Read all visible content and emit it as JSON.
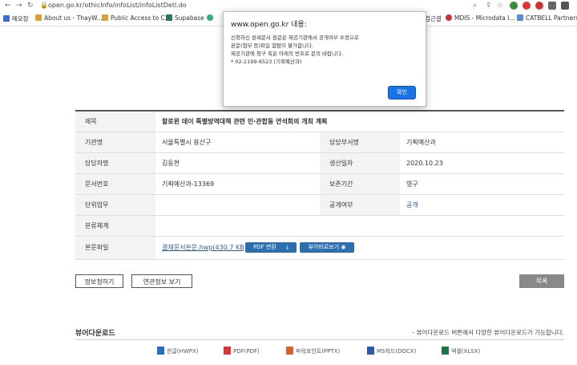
{
  "browser": {
    "url": "open.go.kr/othicInfo/infoList/infoListDetl.do",
    "bookmarks": [
      "메모장",
      "About us - ThayW...",
      "Public Access to C...",
      "Supabase",
      "검근결",
      "MDIS - Microdata I...",
      "CATBELL Partners"
    ]
  },
  "dialog": {
    "title": "www.open.go.kr 내용:",
    "lines": [
      "신청하신 원세문서 원문은 제공기관에서 공개여부 수정으로",
      "본문(첨부 등)파일 열람이 불가합니다.",
      "제공기관에 청구 혹은 아래의 번호로 문의 바랍니다.",
      "* 02-2199-6523 (기획예산과)"
    ],
    "ok": "확인"
  },
  "table": {
    "title_label": "제목",
    "title_value": "할로윈 데이 특별방역대책 관련 민·관합동 연석회의 개최 계획",
    "org_label": "기관명",
    "org_value": "서울특별시 용산구",
    "dept_label": "담당부서명",
    "dept_value": "기획예산과",
    "person_label": "담당자명",
    "person_value": "김동현",
    "date_label": "생산일자",
    "date_value": "2020.10.23",
    "docno_label": "문서번호",
    "docno_value": "기획예산과-13369",
    "keep_label": "보존기간",
    "keep_value": "영구",
    "task_label": "단위업무",
    "task_value": "",
    "open_label": "공개여부",
    "open_value": "공개",
    "class_label": "분류체계",
    "class_value": "",
    "file_label": "본문파일",
    "file_value": "결재문서본문.hwp(430.7 KB)",
    "pdf_btn": "PDF 변환",
    "viewer_btn": "뷰어바로보기"
  },
  "buttons": {
    "request": "정보청하기",
    "related": "연관정보 보기",
    "list": "목록"
  },
  "viewer": {
    "heading": "뷰어다운로드",
    "note": "- 뷰어다운로드 버튼에서 다양한 뷰어다운로드가 가능합니다.",
    "items": [
      "한글(HWPX)",
      "PDF(PDF)",
      "파워포인트(PPTX)",
      "MS워드(DOCX)",
      "엑셀(XLSX)"
    ]
  }
}
